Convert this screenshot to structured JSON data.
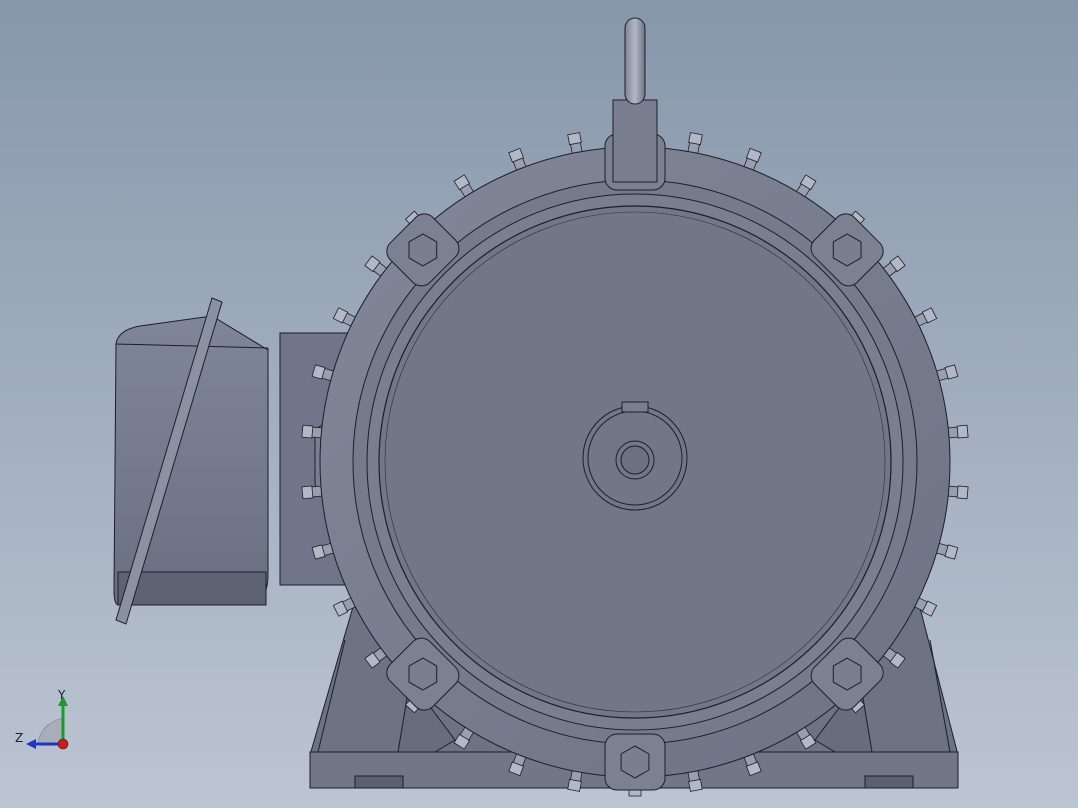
{
  "viewport": {
    "background_top": "#8797ab",
    "background_bottom": "#bcc5d2"
  },
  "model": {
    "body_color": "#737888",
    "edge_color": "#1c1f28",
    "fin_color": "#9a9fb0"
  },
  "triad": {
    "x_label": "",
    "y_label": "Y",
    "z_label": "Z",
    "x_color": "#c81e1e",
    "y_color": "#1a9a28",
    "z_color": "#1e35c8"
  }
}
